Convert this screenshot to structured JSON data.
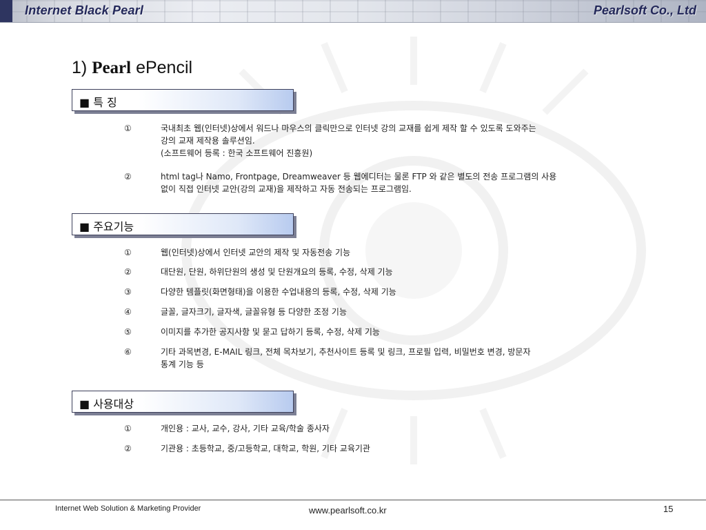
{
  "header": {
    "left_title": "Internet Black Pearl",
    "right_title": "Pearlsoft Co., Ltd"
  },
  "title": {
    "number": "1)",
    "brand": "Pearl",
    "product": "ePencil"
  },
  "sections": [
    {
      "label": "■ 특 징",
      "items": [
        {
          "num": "①",
          "lines": [
            "국내최초 웹(인터넷)상에서 워드나 마우스의 클릭만으로 인터넷 강의 교재를 쉽게 제작 할 수 있도록 도와주는",
            "강의 교재 제작용 솔루션임.",
            "(소프트웨어 등록 : 한국 소프트웨어 진흥원)"
          ]
        },
        {
          "num": "②",
          "lines": [
            "html tag나 Namo, Frontpage, Dreamweaver 등 웹에디터는 물론 FTP 와 같은 별도의 전송 프로그램의 사용",
            "없이 직접 인터넷 교안(강의 교재)을 제작하고 자동 전송되는 프로그램임."
          ]
        }
      ]
    },
    {
      "label": "■ 주요기능",
      "items": [
        {
          "num": "①",
          "lines": [
            "웹(인터넷)상에서 인터넷 교안의 제작 및 자동전송 기능"
          ]
        },
        {
          "num": "②",
          "lines": [
            "대단원, 단원, 하위단원의 생성 및 단원개요의 등록, 수정, 삭제 기능"
          ]
        },
        {
          "num": "③",
          "lines": [
            "다양한 템플릿(화면형태)을 이용한 수업내용의 등록, 수정, 삭제 기능"
          ]
        },
        {
          "num": "④",
          "lines": [
            "글꼴, 글자크기, 글자색, 글꼴유형 등 다양한 조정 기능"
          ]
        },
        {
          "num": "⑤",
          "lines": [
            "이미지를 추가한 공지사항 및 묻고 답하기 등록, 수정, 삭제 기능"
          ]
        },
        {
          "num": "⑥",
          "lines": [
            "기타 과목변경, E-MAIL 링크, 전체 목차보기, 추천사이트 등록 및 링크, 프로필 입력, 비밀번호 변경, 방문자",
            "통계 기능 등"
          ]
        }
      ]
    },
    {
      "label": "■ 사용대상",
      "items": [
        {
          "num": "①",
          "lines": [
            "개인용 : 교사, 교수, 강사, 기타 교육/학술 종사자"
          ]
        },
        {
          "num": "②",
          "lines": [
            "기관용 : 초등학교, 중/고등학교, 대학교, 학원, 기타 교육기관"
          ]
        }
      ]
    }
  ],
  "footer": {
    "left": "Internet Web Solution & Marketing Provider",
    "center": "www.pearlsoft.co.kr",
    "page": "15"
  }
}
